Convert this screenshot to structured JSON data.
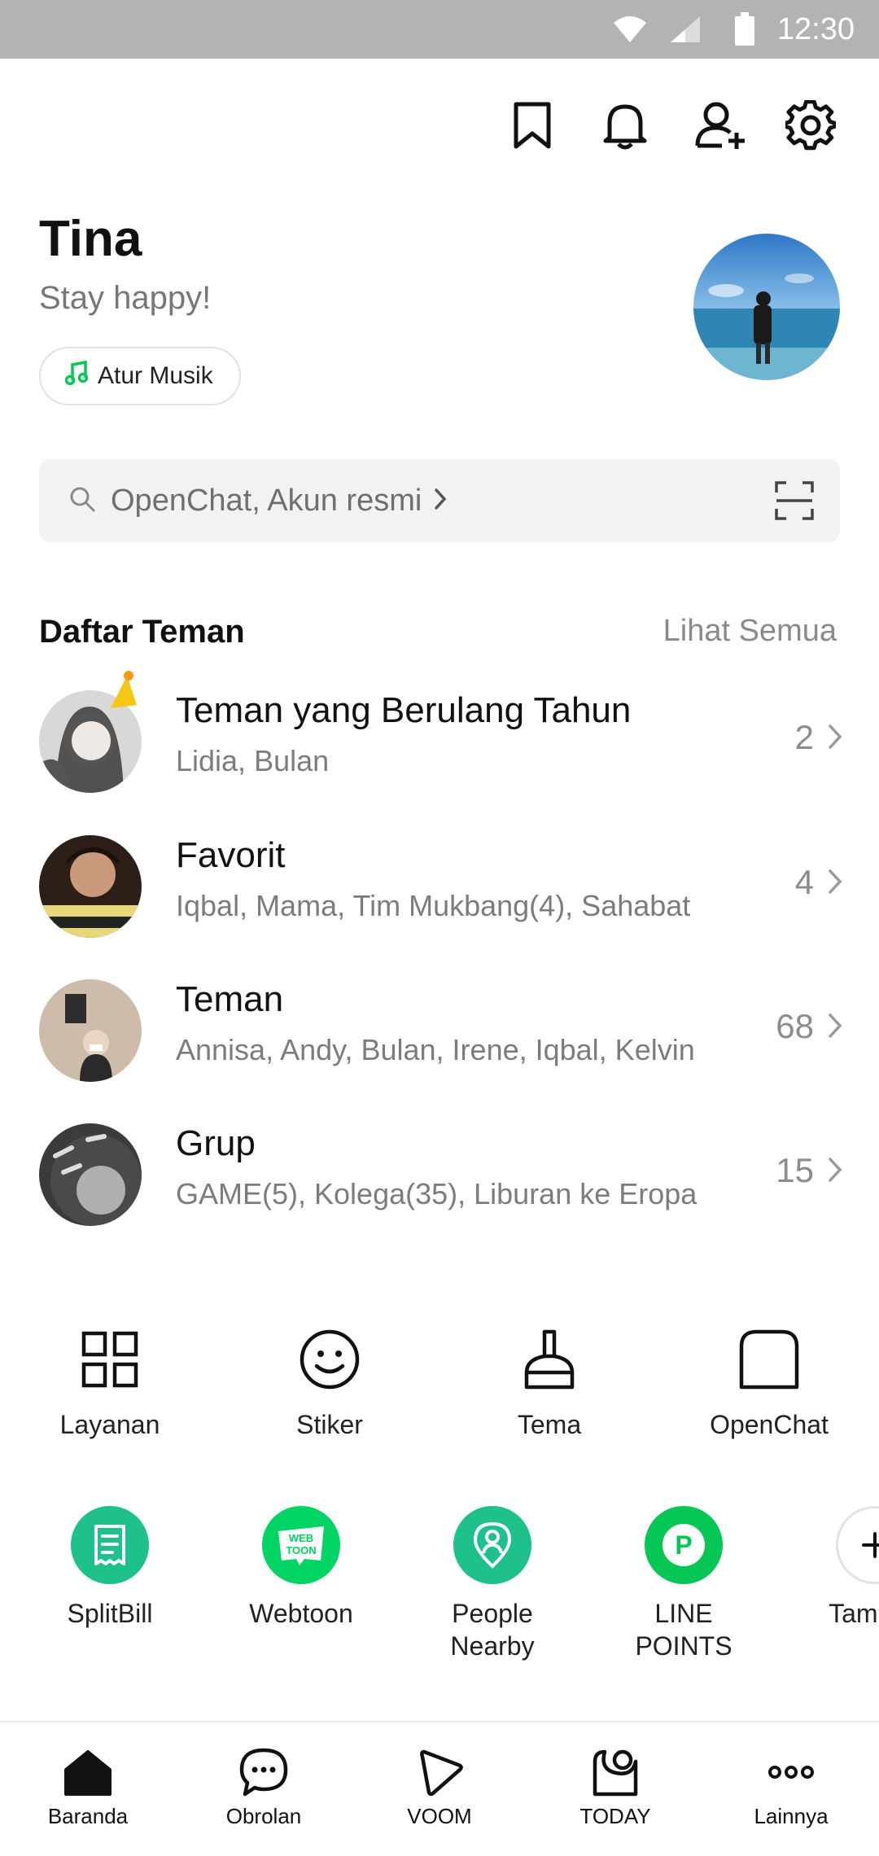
{
  "status_bar": {
    "time": "12:30"
  },
  "header": {
    "icons": [
      "bookmark-icon",
      "bell-icon",
      "add-friend-icon",
      "gear-icon"
    ]
  },
  "profile": {
    "name": "Tina",
    "status": "Stay happy!",
    "music_label": "Atur Musik"
  },
  "search": {
    "placeholder": "OpenChat, Akun resmi"
  },
  "friends": {
    "title": "Daftar Teman",
    "see_all": "Lihat Semua",
    "rows": [
      {
        "title": "Teman yang Berulang Tahun",
        "subtitle": "Lidia, Bulan",
        "count": "2"
      },
      {
        "title": "Favorit",
        "subtitle": "Iqbal, Mama, Tim Mukbang(4), Sahabat",
        "count": "4"
      },
      {
        "title": "Teman",
        "subtitle": "Annisa, Andy, Bulan, Irene, Iqbal, Kelvin",
        "count": "68"
      },
      {
        "title": "Grup",
        "subtitle": "GAME(5), Kolega(35), Liburan ke Eropa",
        "count": "15"
      }
    ]
  },
  "quick_menu": [
    {
      "label": "Layanan",
      "icon": "grid-icon"
    },
    {
      "label": "Stiker",
      "icon": "smiley-icon"
    },
    {
      "label": "Tema",
      "icon": "brush-icon"
    },
    {
      "label": "OpenChat",
      "icon": "openchat-icon"
    }
  ],
  "services": [
    {
      "label": "SplitBill",
      "icon": "receipt-icon",
      "color": "#1ec08b"
    },
    {
      "label": "Webtoon",
      "icon": "webtoon-icon",
      "color": "#00d564",
      "text": "WEB TOON"
    },
    {
      "label": "People Nearby",
      "icon": "location-person-icon",
      "color": "#1ec08b"
    },
    {
      "label": "LINE POINTS",
      "icon": "points-icon",
      "color": "#06c755",
      "text": "P"
    },
    {
      "label": "Tambah",
      "icon": "plus-icon",
      "color": "#ffffff"
    }
  ],
  "bottom_nav": [
    {
      "label": "Baranda",
      "icon": "home-icon"
    },
    {
      "label": "Obrolan",
      "icon": "chat-icon"
    },
    {
      "label": "VOOM",
      "icon": "voom-icon"
    },
    {
      "label": "TODAY",
      "icon": "today-icon"
    },
    {
      "label": "Lainnya",
      "icon": "more-icon"
    }
  ],
  "colors": {
    "accent": "#06c755",
    "text": "#111111",
    "muted": "#7c7c7c"
  }
}
